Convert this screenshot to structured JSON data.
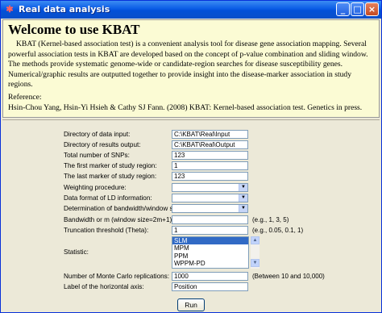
{
  "window": {
    "title": "Real data analysis",
    "buttons": {
      "minimize": "_",
      "maximize": "□",
      "close": "×"
    }
  },
  "info": {
    "heading": "Welcome to use KBAT",
    "intro": "KBAT (Kernel-based association test) is a convenient analysis tool for disease gene association mapping. Several powerful association tests in KBAT are developed based on the concept of p-value combination and sliding window. The methods provide systematic genome-wide or candidate-region searches for disease susceptibility genes. Numerical/graphic results are outputted together to provide insight into the disease-marker association in study regions.",
    "reference_label": "Reference:",
    "reference": "Hsin-Chou Yang, Hsin-Yi Hsieh & Cathy SJ Fann. (2008) KBAT: Kernel-based association test. Genetics in press."
  },
  "form": {
    "data_input": {
      "label": "Directory of data input:",
      "value": "C:\\KBAT\\Real\\Input"
    },
    "results_output": {
      "label": "Directory of results output:",
      "value": "C:\\KBAT\\Real\\Output"
    },
    "total_snps": {
      "label": "Total number of SNPs:",
      "value": "123"
    },
    "first_marker": {
      "label": "The first marker of study region:",
      "value": "1"
    },
    "last_marker": {
      "label": "The last marker of study region:",
      "value": "123"
    },
    "weighting": {
      "label": "Weighting procedure:",
      "value": ""
    },
    "ld_format": {
      "label": "Data format of LD information:",
      "value": ""
    },
    "bandwidth_det": {
      "label": "Determination of bandwidth/window size:",
      "value": ""
    },
    "bandwidth": {
      "label": "Bandwidth or m (window size=2m+1):",
      "value": "",
      "hint": "(e.g., 1, 3, 5)"
    },
    "truncation": {
      "label": "Truncation threshold (Theta):",
      "value": "1",
      "hint": "(e.g., 0.05, 0.1, 1)"
    },
    "statistic": {
      "label": "Statistic:",
      "options": [
        "SLM",
        "MPM",
        "PPM",
        "WPPM-PD"
      ],
      "selected": "SLM"
    },
    "monte_carlo": {
      "label": "Number of Monte Carlo replications:",
      "value": "1000",
      "hint": "(Between 10 and 10,000)"
    },
    "axis_label": {
      "label": "Label of the horizontal axis:",
      "value": "Position"
    },
    "run_label": "Run"
  },
  "icons": {
    "app": "app-icon",
    "select_arrow": "chevron-down-icon",
    "scroll_up": "chevron-up-icon",
    "scroll_down": "chevron-down-icon"
  },
  "colors": {
    "titlebar": "#0a5ce6",
    "info_background": "#fbfbd4",
    "window_background": "#ece9d8",
    "selection": "#316ac5"
  }
}
